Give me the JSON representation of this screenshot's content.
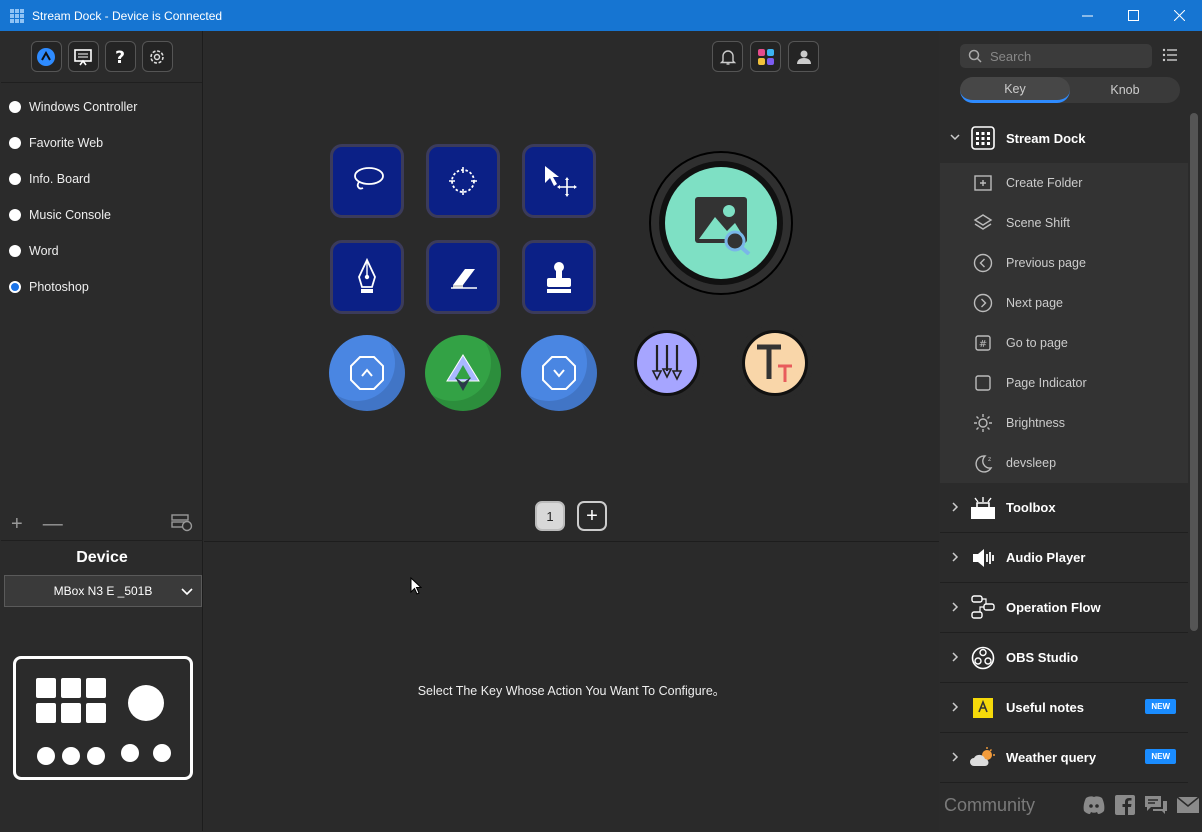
{
  "window": {
    "title": "Stream Dock - Device is Connected"
  },
  "left_panel": {
    "profiles": [
      {
        "label": "Windows Controller",
        "selected": false
      },
      {
        "label": "Favorite Web",
        "selected": false
      },
      {
        "label": "Info. Board",
        "selected": false
      },
      {
        "label": "Music Console",
        "selected": false
      },
      {
        "label": "Word",
        "selected": false
      },
      {
        "label": "Photoshop",
        "selected": true
      }
    ],
    "add_symbol": "+",
    "remove_symbol": "—",
    "device_title": "Device",
    "device_selected": "MBox N3 E _501B"
  },
  "center": {
    "page_number": "1",
    "add_page_symbol": "+",
    "hint": "Select The Key Whose Action You Want To Configure。",
    "keys": [
      "lasso-icon",
      "lasso-select-icon",
      "move-tool-icon",
      "pen-tool-icon",
      "eraser-icon",
      "stamp-icon",
      "knob-up-icon",
      "knob-press-icon",
      "knob-down-icon"
    ],
    "round_keys": [
      "image-search-icon",
      "brush-adjust-icon",
      "text-tool-icon"
    ]
  },
  "right_panel": {
    "search_placeholder": "Search",
    "tabs": [
      "Key",
      "Knob"
    ],
    "active_tab": "Key",
    "expanded_category": "Stream Dock",
    "stream_dock_actions": [
      "Create Folder",
      "Scene Shift",
      "Previous page",
      "Next page",
      "Go to page",
      "Page Indicator",
      "Brightness",
      "devsleep"
    ],
    "categories": [
      {
        "label": "Toolbox",
        "badge": ""
      },
      {
        "label": "Audio Player",
        "badge": ""
      },
      {
        "label": "Operation Flow",
        "badge": ""
      },
      {
        "label": "OBS Studio",
        "badge": ""
      },
      {
        "label": "Useful notes",
        "badge": "NEW"
      },
      {
        "label": "Weather query",
        "badge": "NEW"
      }
    ],
    "community_label": "Community"
  },
  "colors": {
    "titlebar": "#1675d2",
    "key_bg": "#0b2086",
    "accent": "#2e8bff",
    "teal": "#7ee0c4",
    "badge": "#1a8cff"
  }
}
